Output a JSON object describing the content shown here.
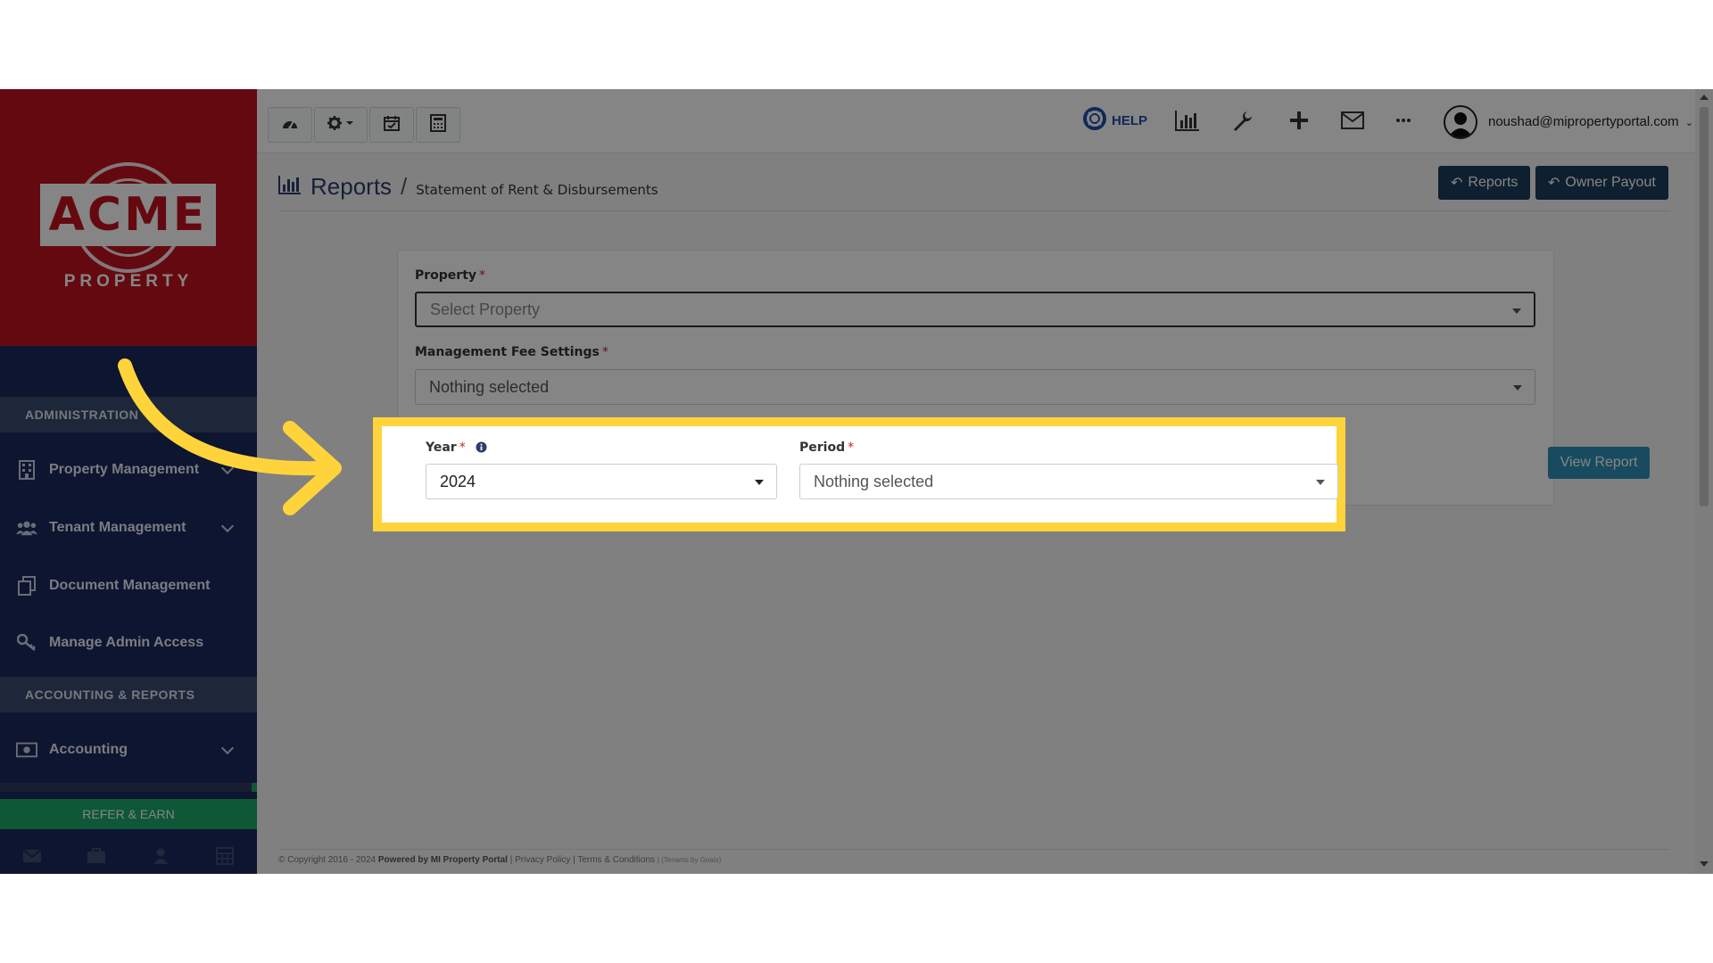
{
  "brand": {
    "logo_text": "ACME",
    "logo_subtext": "PROPERTY"
  },
  "sidebar": {
    "sections": [
      {
        "header": "ADMINISTRATION",
        "items": [
          {
            "label": "Property Management",
            "icon": "building-icon",
            "has_chevron": true
          },
          {
            "label": "Tenant Management",
            "icon": "users-icon",
            "has_chevron": true
          },
          {
            "label": "Document Management",
            "icon": "documents-icon",
            "has_chevron": false
          },
          {
            "label": "Manage Admin Access",
            "icon": "key-icon",
            "has_chevron": false
          }
        ]
      },
      {
        "header": "ACCOUNTING & REPORTS",
        "items": [
          {
            "label": "Accounting",
            "icon": "money-icon",
            "has_chevron": true
          }
        ]
      }
    ],
    "refer_label": "REFER & EARN",
    "footer_icons": [
      "envelope-icon",
      "briefcase-icon",
      "user-icon",
      "calculator-icon"
    ]
  },
  "topbar": {
    "left_buttons": [
      "dashboard-icon",
      "gear-dropdown-icon",
      "calendar-check-icon",
      "calculator-icon"
    ],
    "help_label": "HELP",
    "right_icons": [
      "bar-chart-icon",
      "wrench-icon",
      "plus-icon",
      "envelope-icon",
      "more-icon"
    ],
    "user_email": "noushad@mipropertyportal.com"
  },
  "page": {
    "title": "Reports",
    "separator": "/",
    "subtitle": "Statement of Rent & Disbursements",
    "buttons": {
      "reports": "Reports",
      "owner_payout": "Owner Payout"
    }
  },
  "form": {
    "property": {
      "label": "Property",
      "required": "*",
      "placeholder": "Select Property"
    },
    "management_fee": {
      "label": "Management Fee Settings",
      "required": "*",
      "value": "Nothing selected"
    },
    "year": {
      "label": "Year",
      "required": "*",
      "value": "2024"
    },
    "period": {
      "label": "Period",
      "required": "*",
      "value": "Nothing selected"
    },
    "view_report_label": "View Report"
  },
  "footer": {
    "copyright_prefix": "© Copyright 2016 - 2024",
    "powered_by": "Powered by MI Property Portal",
    "privacy": "| Privacy Policy",
    "terms": "| Terms & Conditions",
    "tiny_note": "| (Tenants by Goals)"
  },
  "colors": {
    "sidebar_bg": "#1b2a5c",
    "logo_bg": "#c1121f",
    "highlight": "#ffd43b",
    "primary_button": "#1c3d5a",
    "view_button": "#2f90b8",
    "refer_button": "#1ba86a"
  }
}
